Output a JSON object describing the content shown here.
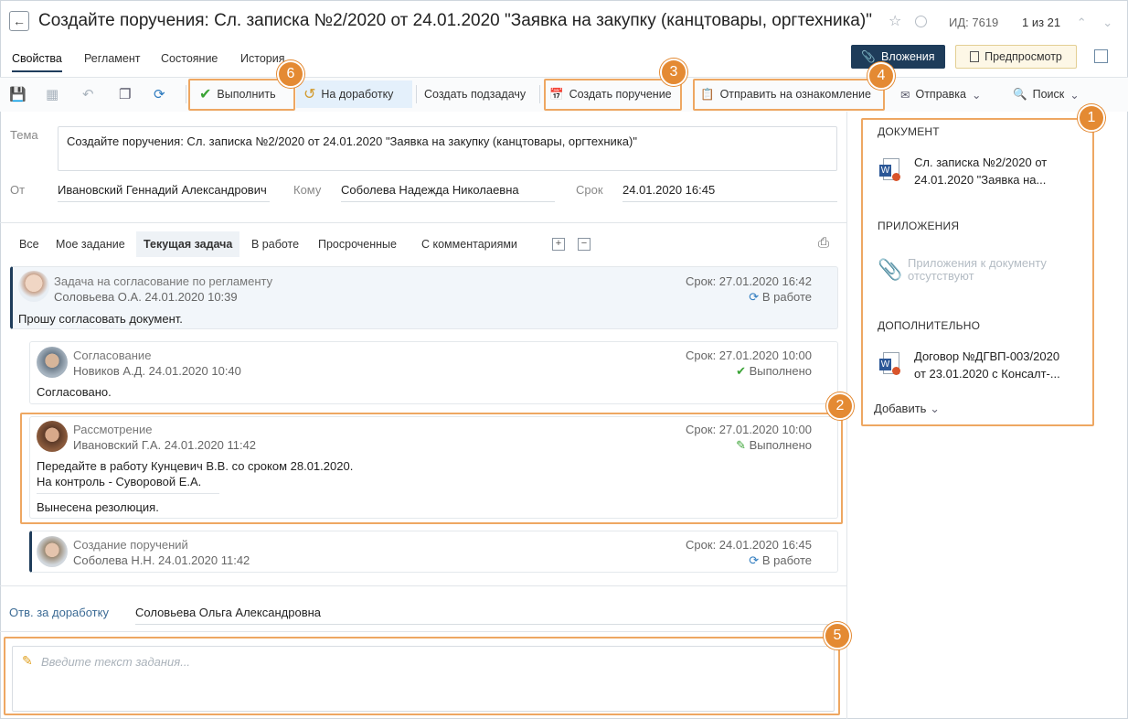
{
  "header": {
    "title": "Создайте поручения: Сл. записка №2/2020 от 24.01.2020 \"Заявка на закупку (канцтовары, оргтехника)\"",
    "id_label": "ИД: 7619",
    "pager": "1 из 21"
  },
  "tabs": [
    "Свойства",
    "Регламент",
    "Состояние",
    "История"
  ],
  "buttons": {
    "attachments": "Вложения",
    "preview": "Предпросмотр"
  },
  "toolbar": {
    "execute": "Выполнить",
    "rework": "На доработку",
    "subtask": "Создать подзадачу",
    "create_order": "Создать поручение",
    "send_review": "Отправить на ознакомление",
    "send": "Отправка",
    "search": "Поиск"
  },
  "form": {
    "tema_label": "Тема",
    "tema_value": "Создайте поручения: Сл. записка №2/2020 от 24.01.2020 \"Заявка на закупку (канцтовары, оргтехника)\"",
    "from_label": "От",
    "from_value": "Ивановский Геннадий Александрович",
    "to_label": "Кому",
    "to_value": "Соболева Надежда Николаевна",
    "due_label": "Срок",
    "due_value": "24.01.2020 16:45"
  },
  "filters": [
    "Все",
    "Мое задание",
    "Текущая задача",
    "В работе",
    "Просроченные",
    "С комментариями"
  ],
  "tasks": [
    {
      "type": "Задача на согласование по регламенту",
      "who": "Соловьева О.А.  24.01.2020 10:39",
      "due": "Срок: 27.01.2020 16:42",
      "status": "В работе",
      "text": "Прошу согласовать документ."
    },
    {
      "type": "Согласование",
      "who": "Новиков А.Д.  24.01.2020 10:40",
      "due": "Срок: 27.01.2020 10:00",
      "status": "Выполнено",
      "text": "Согласовано."
    },
    {
      "type": "Рассмотрение",
      "who": "Ивановский Г.А.  24.01.2020 11:42",
      "due": "Срок: 27.01.2020 10:00",
      "status": "Выполнено",
      "text1": "Передайте в работу Кунцевич В.В. со сроком 28.01.2020.",
      "text2": "На контроль - Суворовой Е.А.",
      "text3": "Вынесена резолюция."
    },
    {
      "type": "Создание поручений",
      "who": "Соболева Н.Н.  24.01.2020 11:42",
      "due": "Срок: 24.01.2020 16:45",
      "status": "В работе"
    }
  ],
  "right_panel": {
    "doc_head": "ДОКУМЕНТ",
    "doc_line1": "Сл. записка №2/2020 от",
    "doc_line2": "24.01.2020 \"Заявка на...",
    "att_head": "ПРИЛОЖЕНИЯ",
    "att_empty1": "Приложения к документу",
    "att_empty2": "отсутствуют",
    "extra_head": "ДОПОЛНИТЕЛЬНО",
    "extra_line1": "Договор №ДГВП-003/2020",
    "extra_line2": "от 23.01.2020 с Консалт-...",
    "add": "Добавить"
  },
  "bottom": {
    "rework_label": "Отв. за доработку",
    "rework_value": "Соловьева Ольга Александровна",
    "task_placeholder": "Введите текст задания..."
  },
  "callouts": [
    "1",
    "2",
    "3",
    "4",
    "5",
    "6"
  ],
  "colors": {
    "accent": "#1e3c5a",
    "callout": "#e48a33",
    "callout_border": "#eea762"
  }
}
